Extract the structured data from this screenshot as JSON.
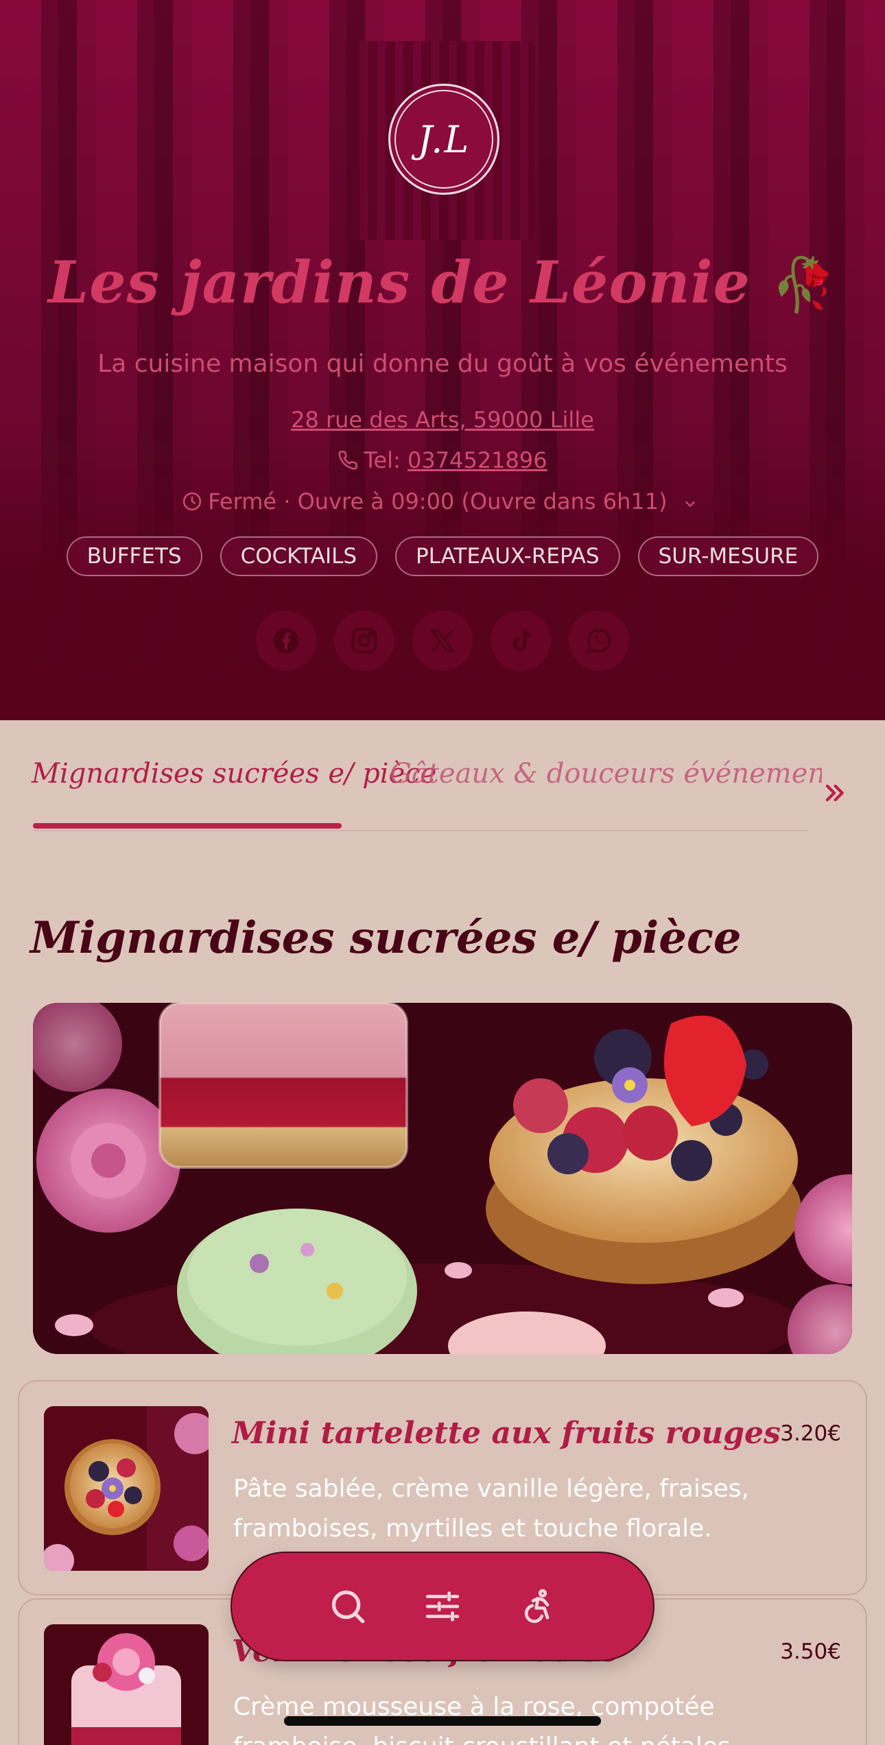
{
  "header": {
    "logo_text": "J.L",
    "title": "Les jardins de Léonie",
    "title_emoji": "🥀",
    "subtitle": "La cuisine maison qui donne du goût à vos événements",
    "address": "28 rue des Arts, 59000 Lille",
    "phone_label": "Tel: ",
    "phone_number": "0374521896",
    "hours_status": "Fermé · Ouvre à 09:00 (Ouvre dans 6h11)",
    "categories": [
      "BUFFETS",
      "COCKTAILS",
      "PLATEAUX-REPAS",
      "SUR-MESURE"
    ],
    "socials": [
      "facebook-icon",
      "instagram-icon",
      "x-icon",
      "tiktok-icon",
      "whatsapp-icon"
    ]
  },
  "tabs": [
    {
      "label": "Mignardises sucrées e/ pièce",
      "active": true
    },
    {
      "label": "Gâteaux & douceurs événementielles e/ pièce",
      "active": false
    }
  ],
  "section": {
    "title": "Mignardises sucrées e/ pièce"
  },
  "items": [
    {
      "name": "Mini tartelette aux fruits rouges",
      "price": "3.20€",
      "description": "Pâte sablée, crème vanille légère, fraises, framboises, myrtilles et touche florale."
    },
    {
      "name": "Verrine rose framboise",
      "price": "3.50€",
      "description": "Crème mousseuse à la rose, compotée framboise, biscuit croustillant et pétales décoratifs."
    }
  ],
  "toolbar": {
    "buttons": [
      "search-icon",
      "filters-icon",
      "accessibility-icon"
    ]
  },
  "colors": {
    "brand": "#c01e4b",
    "hero_bg": "#86093a",
    "page_bg": "#dcc6bc",
    "text_dark": "#4a0417"
  }
}
